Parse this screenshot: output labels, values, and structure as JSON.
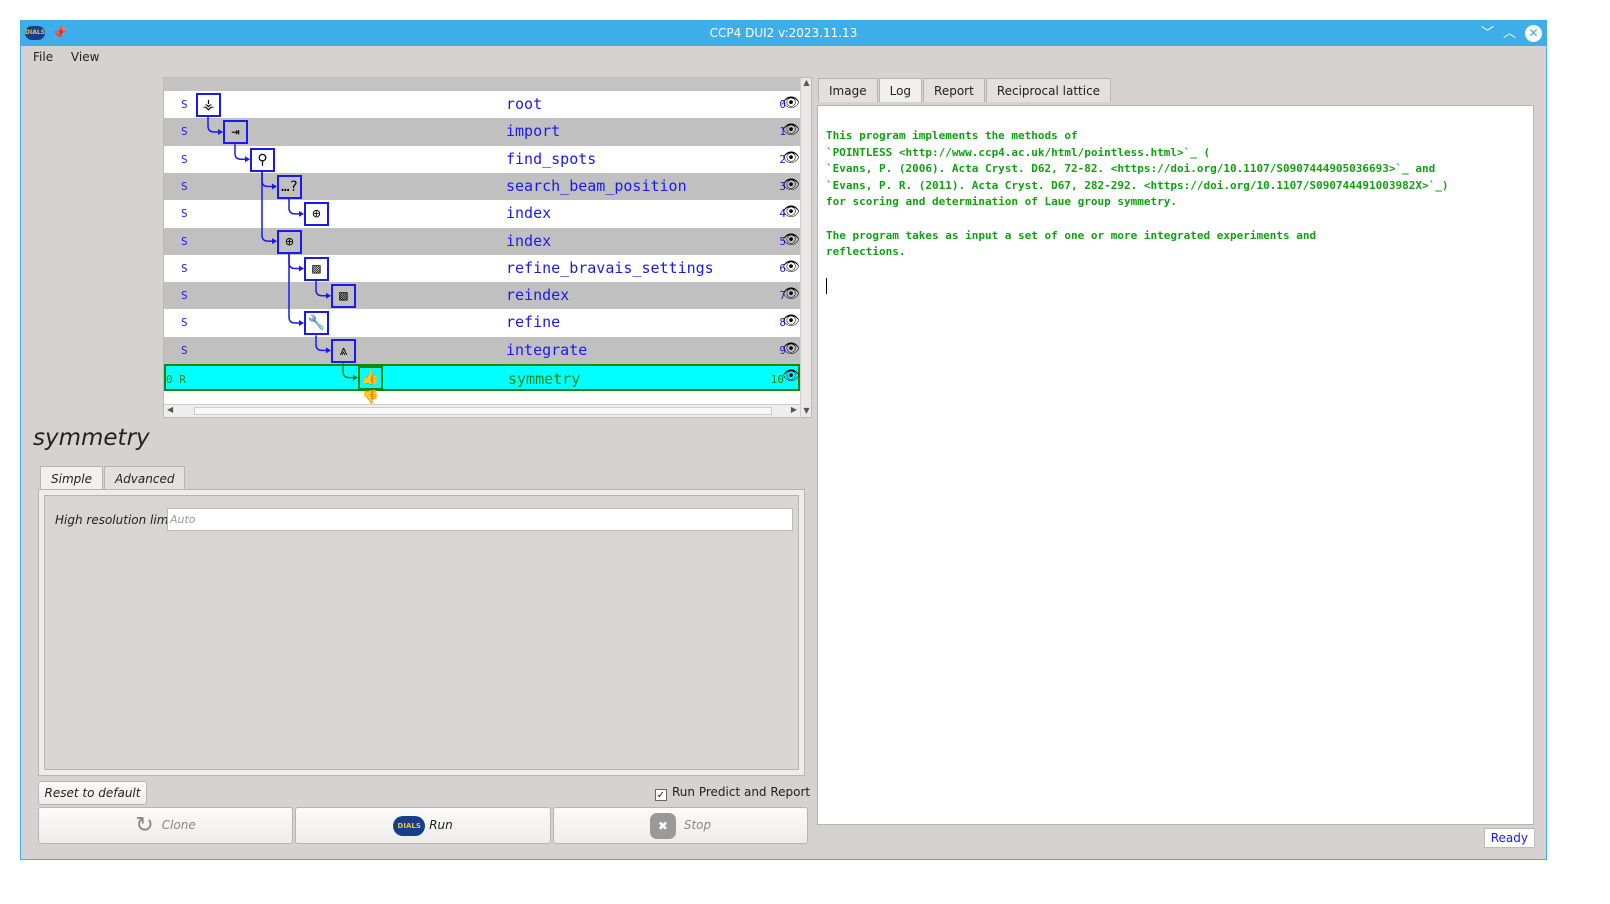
{
  "window": {
    "title": "CCP4 DUI2 v:2023.11.13",
    "logo_text": "DIALS"
  },
  "menu": [
    "File",
    "View"
  ],
  "tree": {
    "rows": [
      {
        "status": "S",
        "name": "root",
        "num": "0",
        "depth": 0,
        "parent": null,
        "icon": "root-icon",
        "glyph": "⚶"
      },
      {
        "status": "S",
        "name": "import",
        "num": "1",
        "depth": 1,
        "parent": 0,
        "icon": "import-icon",
        "glyph": "⇥"
      },
      {
        "status": "S",
        "name": "find_spots",
        "num": "2",
        "depth": 2,
        "parent": 1,
        "icon": "find-spots-icon",
        "glyph": "⚲"
      },
      {
        "status": "S",
        "name": "search_beam_position",
        "num": "3",
        "depth": 3,
        "parent": 2,
        "icon": "search-beam-icon",
        "glyph": "…?"
      },
      {
        "status": "S",
        "name": "index",
        "num": "4",
        "depth": 4,
        "parent": 3,
        "icon": "index-icon",
        "glyph": "⊕"
      },
      {
        "status": "S",
        "name": "index",
        "num": "5",
        "depth": 3,
        "parent": 2,
        "icon": "index-icon",
        "glyph": "⊕"
      },
      {
        "status": "S",
        "name": "refine_bravais_settings",
        "num": "6",
        "depth": 4,
        "parent": 5,
        "icon": "refine-bravais-icon",
        "glyph": "▨"
      },
      {
        "status": "S",
        "name": "reindex",
        "num": "7",
        "depth": 5,
        "parent": 6,
        "icon": "reindex-icon",
        "glyph": "▧"
      },
      {
        "status": "S",
        "name": "refine",
        "num": "8",
        "depth": 4,
        "parent": 5,
        "icon": "wrench-icon",
        "glyph": "🔧"
      },
      {
        "status": "S",
        "name": "integrate",
        "num": "9",
        "depth": 5,
        "parent": 8,
        "icon": "integrate-icon",
        "glyph": "⩓"
      },
      {
        "status": "0  R",
        "name": "symmetry",
        "num": "10",
        "depth": 6,
        "parent": 9,
        "icon": "thumbs-icon",
        "glyph": "👍👎",
        "selected": true
      }
    ],
    "eye_glyph": "👁"
  },
  "step_title": "symmetry",
  "param_tabs": [
    "Simple",
    "Advanced"
  ],
  "params": {
    "high_res_label": "High resolution limit",
    "high_res_placeholder": "Auto"
  },
  "reset_label": "Reset to default",
  "run_predict": {
    "label": "Run Predict and Report",
    "checked": true,
    "mark": "✓"
  },
  "buttons": {
    "clone": "Clone",
    "run": "Run",
    "stop": "Stop"
  },
  "right_tabs": [
    "Image",
    "Log",
    "Report",
    "Reciprocal lattice"
  ],
  "right_active": "Log",
  "log_text": "This program implements the methods of\n`POINTLESS <http://www.ccp4.ac.uk/html/pointless.html>`_ (\n`Evans, P. (2006). Acta Cryst. D62, 72-82. <https://doi.org/10.1107/S0907444905036693>`_ and\n`Evans, P. R. (2011). Acta Cryst. D67, 282-292. <https://doi.org/10.1107/S090744491003982X>`_)\nfor scoring and determination of Laue group symmetry.\n\nThe program takes as input a set of one or more integrated experiments and\nreflections.",
  "status": "Ready",
  "colors": {
    "titlebar": "#3daee9",
    "node": "#1a1aee",
    "selected_bg": "#00ffff",
    "selected_fg": "#118811",
    "log": "#11a011"
  }
}
